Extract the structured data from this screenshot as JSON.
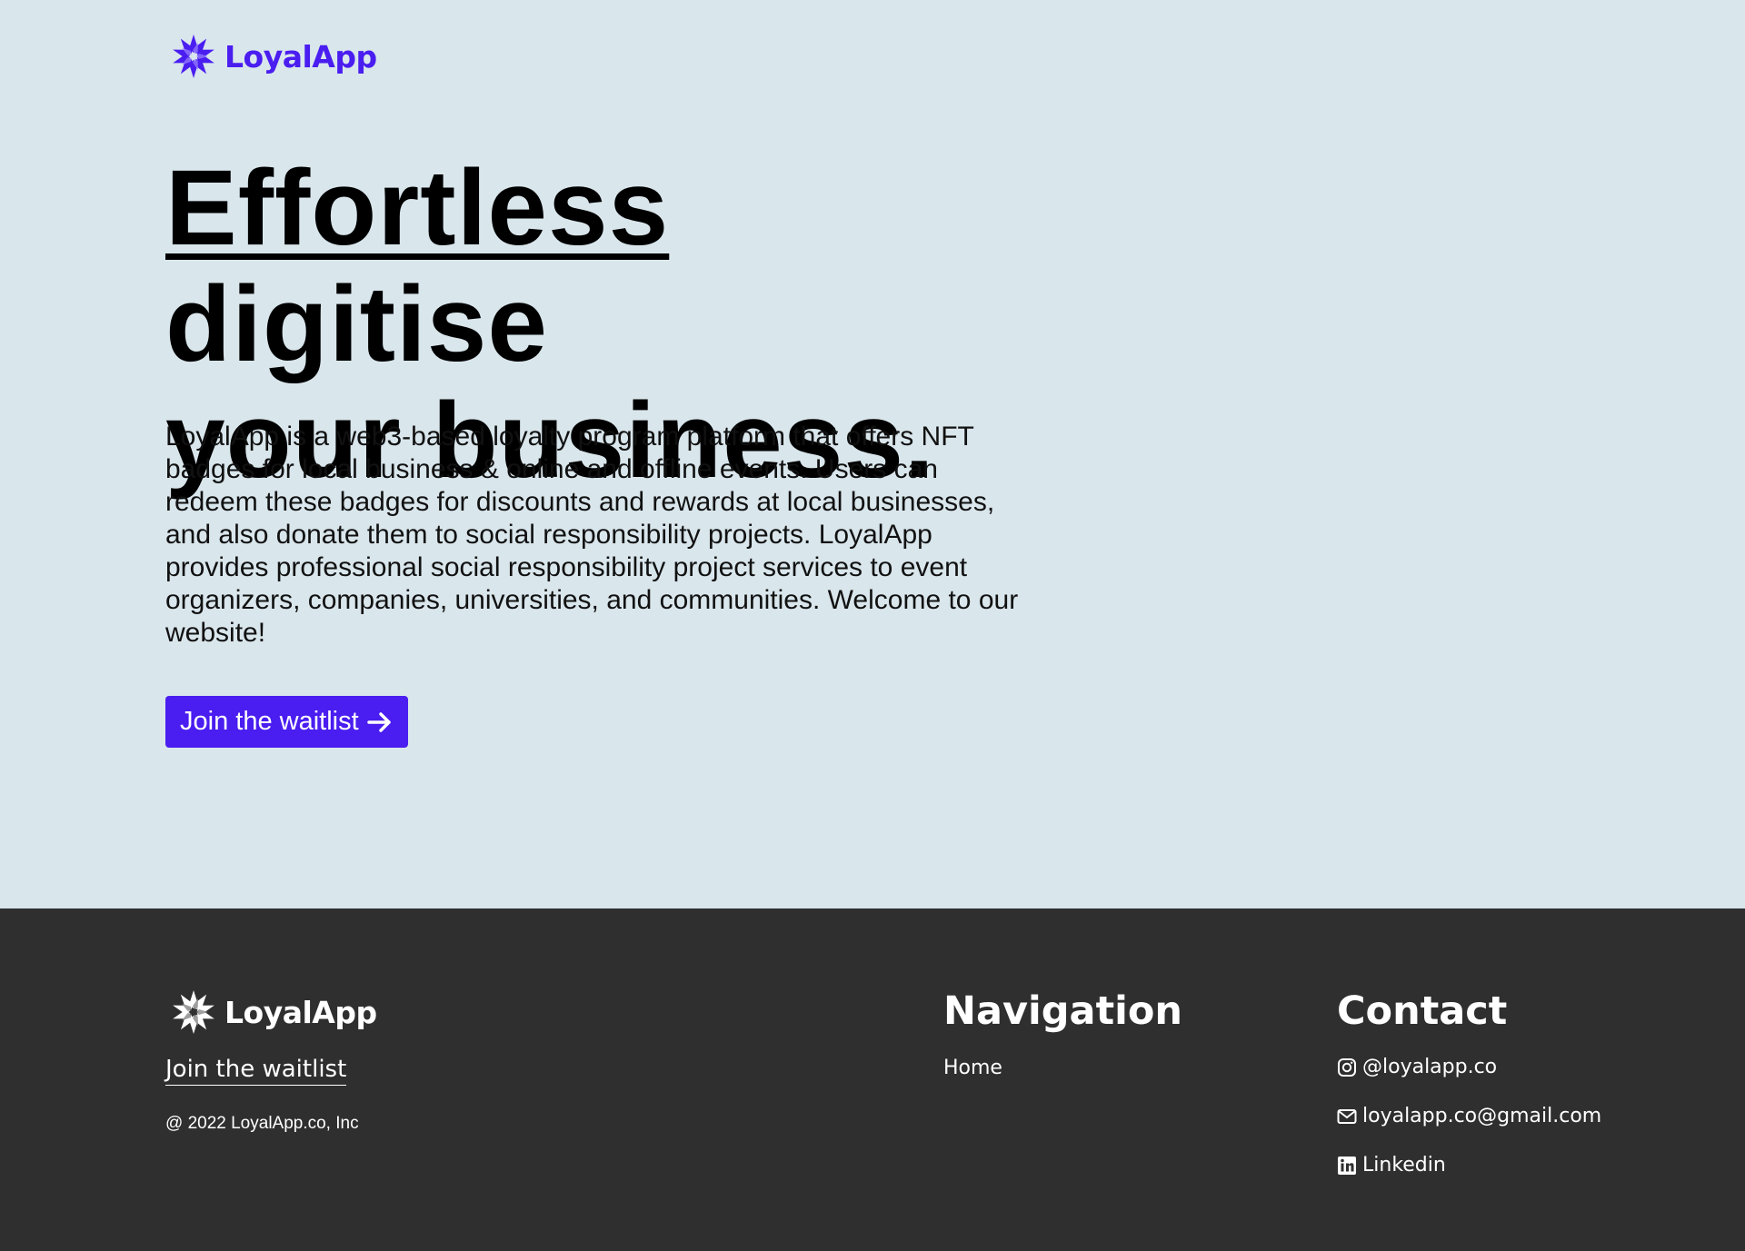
{
  "brand": {
    "name": "LoyalApp",
    "accent_color": "#4a1df0",
    "logo_icon": "starburst-logo-icon"
  },
  "hero": {
    "headline_underlined": "Effortless",
    "headline_rest_line1": " digitise",
    "headline_line2": "your business.",
    "description": "LoyalApp is a web3-based loyalty program platform that offers NFT badges for local business & online and offline events. Users can redeem these badges for discounts and rewards at local businesses, and also donate them to social responsibility projects. LoyalApp provides professional social responsibility project services to event organizers, companies, universities, and communities. Welcome to our website!",
    "cta_label": "Join the waitlist",
    "cta_icon": "arrow-right-icon"
  },
  "footer": {
    "brand_name": "LoyalApp",
    "waitlist_link": "Join the waitlist",
    "copyright": "@ 2022 LoyalApp.co, Inc",
    "navigation": {
      "title": "Navigation",
      "items": [
        "Home"
      ]
    },
    "contact": {
      "title": "Contact",
      "instagram": "@loyalapp.co",
      "email": "loyalapp.co@gmail.com",
      "linkedin": "Linkedin"
    },
    "background_color": "#2f2f2f"
  },
  "page_background": "#d9e6ec"
}
